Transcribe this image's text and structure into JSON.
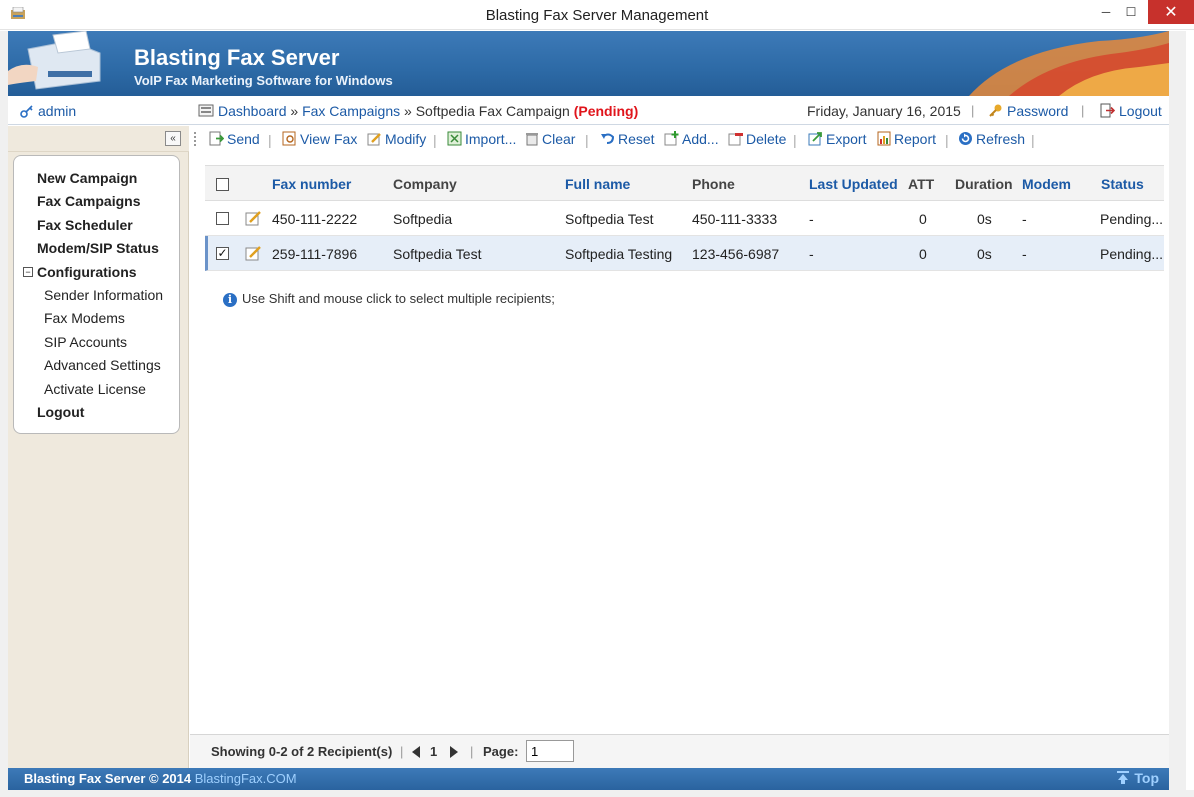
{
  "window": {
    "title": "Blasting Fax Server Management",
    "minimize": "─",
    "maximize": "☐",
    "close": "✕"
  },
  "banner": {
    "title": "Blasting Fax Server",
    "subtitle": "VoIP Fax Marketing Software for Windows"
  },
  "userbar": {
    "user": "admin",
    "breadcrumb": {
      "dashboard": "Dashboard",
      "sep": "»",
      "campaigns": "Fax Campaigns",
      "current": "Softpedia Fax Campaign",
      "status": "(Pending)"
    },
    "date": "Friday, January 16, 2015",
    "pipe": "|",
    "password": "Password",
    "logout": "Logout"
  },
  "sidebar": {
    "collapse": "«",
    "items": [
      {
        "label": "New Campaign"
      },
      {
        "label": "Fax Campaigns"
      },
      {
        "label": "Fax Scheduler"
      },
      {
        "label": "Modem/SIP Status"
      },
      {
        "label": "Configurations",
        "expander": "−"
      },
      {
        "label": "Sender Information"
      },
      {
        "label": "Fax Modems"
      },
      {
        "label": "SIP Accounts"
      },
      {
        "label": "Advanced Settings"
      },
      {
        "label": "Activate License"
      },
      {
        "label": "Logout"
      }
    ]
  },
  "toolbar": {
    "send": "Send",
    "view_fax": "View Fax",
    "modify": "Modify",
    "import": "Import...",
    "clear": "Clear",
    "reset": "Reset",
    "add": "Add...",
    "delete": "Delete",
    "export": "Export",
    "report": "Report",
    "refresh": "Refresh",
    "sep": "|"
  },
  "grid": {
    "columns": [
      "Fax number",
      "Company",
      "Full name",
      "Phone",
      "Last Updated",
      "ATT",
      "Duration",
      "Modem",
      "Status"
    ],
    "rows": [
      {
        "checked": false,
        "check_mark": "",
        "fax": "450-111-2222",
        "company": "Softpedia",
        "fullname": "Softpedia Test",
        "phone": "450-111-3333",
        "updated": "-",
        "att": "0",
        "duration": "0s",
        "modem": "-",
        "status": "Pending..."
      },
      {
        "checked": true,
        "check_mark": "✓",
        "fax": "259-111-7896",
        "company": "Softpedia Test",
        "fullname": "Softpedia Testing",
        "phone": "123-456-6987",
        "updated": "-",
        "att": "0",
        "duration": "0s",
        "modem": "-",
        "status": "Pending..."
      }
    ]
  },
  "hint": {
    "icon": "i",
    "text": "Use Shift and mouse click to select multiple recipients;"
  },
  "pager": {
    "showing": "Showing 0-2 of 2 Recipient(s)",
    "page_number": "1",
    "page_label": "Page:",
    "page_value": "1",
    "pipe": "|"
  },
  "footer": {
    "copyright": "Blasting Fax Server © 2014",
    "site": "BlastingFax.COM",
    "top": "Top"
  },
  "colors": {
    "accent": "#1c5aa6",
    "banner": "#2d6aa6",
    "pending": "#e0141b",
    "sidebar": "#efe9dd"
  }
}
